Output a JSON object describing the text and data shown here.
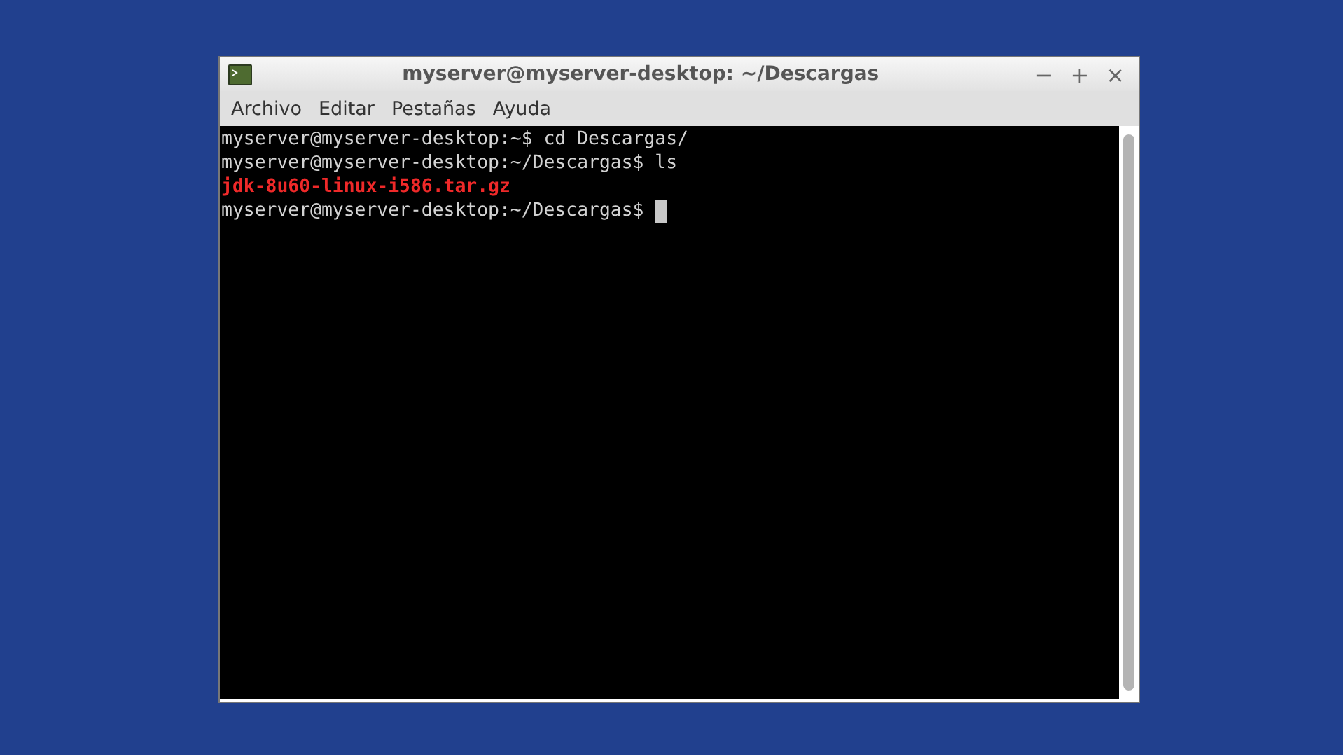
{
  "window": {
    "title": "myserver@myserver-desktop: ~/Descargas",
    "controls": [
      "−",
      "+",
      "×"
    ]
  },
  "menu": [
    "Archivo",
    "Editar",
    "Pestañas",
    "Ayuda"
  ],
  "terminal": {
    "lines": [
      {
        "kind": "prompt",
        "text": "myserver@myserver-desktop:~$ cd Descargas/",
        "cursor": false
      },
      {
        "kind": "prompt",
        "text": "myserver@myserver-desktop:~/Descargas$ ls",
        "cursor": false
      },
      {
        "kind": "archive",
        "text": "jdk-8u60-linux-i586.tar.gz",
        "cursor": false
      },
      {
        "kind": "prompt",
        "text": "myserver@myserver-desktop:~/Descargas$ ",
        "cursor": true
      }
    ]
  }
}
